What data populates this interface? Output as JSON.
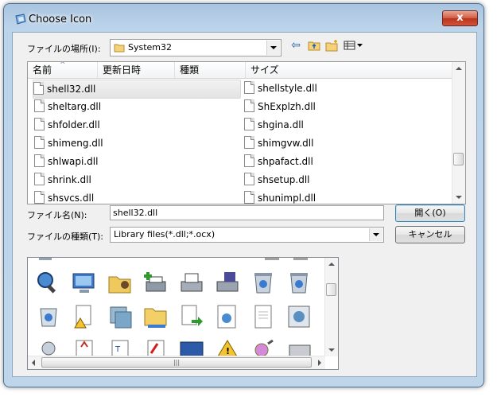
{
  "window": {
    "title": "Choose Icon",
    "close_glyph": "x"
  },
  "location": {
    "label": "ファイルの場所(I):",
    "value": "System32"
  },
  "columns": [
    "名前",
    "更新日時",
    "種類",
    "サイズ"
  ],
  "files_col1": [
    "shell32.dll",
    "sheltarg.dll",
    "shfolder.dll",
    "shimeng.dll",
    "shlwapi.dll",
    "shrink.dll",
    "shsvcs.dll"
  ],
  "files_col2": [
    "shellstyle.dll",
    "ShExplzh.dll",
    "shgina.dll",
    "shimgvw.dll",
    "shpafact.dll",
    "shsetup.dll",
    "shunimpl.dll"
  ],
  "selected_file": "shell32.dll",
  "filename": {
    "label": "ファイル名(N):",
    "value": "shell32.dll"
  },
  "filetype": {
    "label": "ファイルの種類(T):",
    "value": "Library files(*.dll;*.ocx)"
  },
  "buttons": {
    "open": "開く(O)",
    "cancel": "キャンセル"
  },
  "icons_grid": {
    "row1": [
      "search-icon",
      "monitor-gear-icon",
      "folder-user-icon",
      "network-printer-icon",
      "printer-icon",
      "fax-printer-icon",
      "recycle-bin-full-icon",
      "recycle-bin-icon"
    ],
    "row2": [
      "recycle-bin-icon",
      "warning-document-icon",
      "stacked-windows-icon",
      "folder-open-icon",
      "document-arrow-icon",
      "settings-document-icon",
      "blank-document-icon",
      "gear-window-icon"
    ],
    "row3": [
      "settings-icon",
      "pdf-document-icon",
      "text-document-icon",
      "acrobat-icon",
      "monitor-icon",
      "warning-icon",
      "cd-icon",
      "computer-icon"
    ]
  },
  "colors": {
    "title_bar": "#bcd4ea",
    "close_button": "#c94a33",
    "selection": "#e8e8e8"
  }
}
